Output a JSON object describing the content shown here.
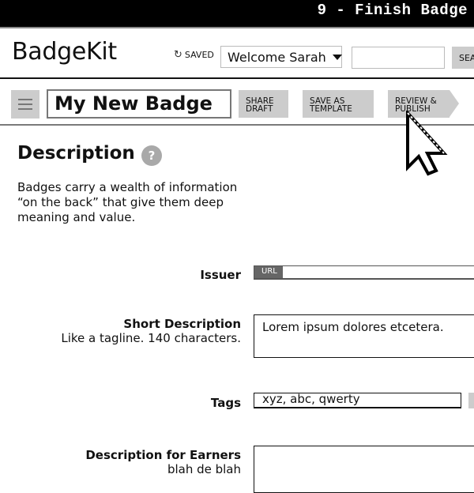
{
  "window": {
    "title": "9 - Finish Badge"
  },
  "header": {
    "logo": "BadgeKit",
    "save_status": "SAVED",
    "save_icon": "refresh-icon",
    "user_menu": {
      "selected": "Welcome Sarah"
    },
    "search": {
      "value": "",
      "placeholder": "",
      "button_label": "SEA"
    }
  },
  "toolbar": {
    "menu_icon": "hamburger-icon",
    "badge_name": "My New Badge",
    "buttons": [
      {
        "line1": "SHARE",
        "line2": "DRAFT"
      },
      {
        "line1": "SAVE AS",
        "line2": "TEMPLATE"
      },
      {
        "line1": "REVIEW &",
        "line2": "PUBLISH"
      }
    ]
  },
  "section": {
    "title": "Description",
    "help_icon_glyph": "?",
    "description": "Badges carry a wealth of information “on the back” that give them deep meaning and value."
  },
  "form": {
    "issuer": {
      "label": "Issuer",
      "prefix": "URL",
      "value": ""
    },
    "short_description": {
      "label": "Short Description",
      "hint": "Like a tagline. 140 characters.",
      "value": "Lorem ipsum dolores etcetera."
    },
    "tags": {
      "label": "Tags",
      "value": "xyz, abc, qwerty"
    },
    "earner_description": {
      "label": "Description for Earners",
      "hint": "blah de blah",
      "value": ""
    }
  },
  "colors": {
    "button_gray": "#cccccc",
    "help_gray": "#a9a9a9",
    "url_tag": "#666666",
    "title_bar": "#000000"
  }
}
